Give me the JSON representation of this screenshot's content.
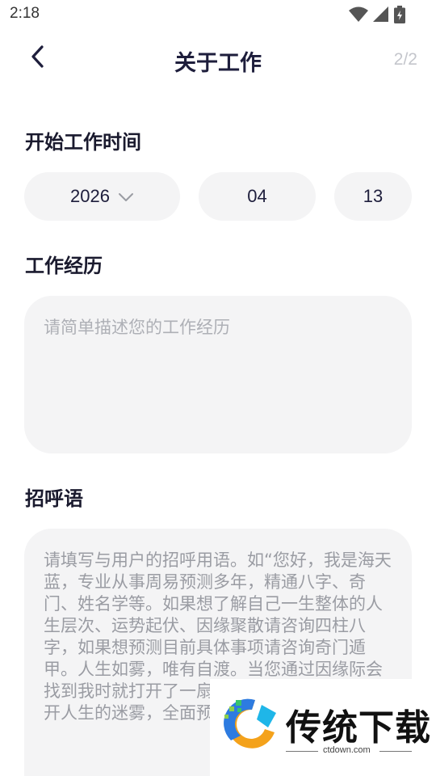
{
  "status": {
    "time": "2:18"
  },
  "nav": {
    "title": "关于工作",
    "step": "2/2"
  },
  "start_time": {
    "label": "开始工作时间",
    "year": "2026",
    "month": "04",
    "day": "13"
  },
  "experience": {
    "label": "工作经历",
    "placeholder": "请简单描述您的工作经历"
  },
  "greeting": {
    "label": "招呼语",
    "text": "请填写与用户的招呼用语。如“您好，我是海天蓝，专业从事周易预测多年，精通八字、奇门、姓名学等。如果想了解自己一生整体的人生层次、运势起伏、因缘聚散请咨询四柱八字，如果想预测目前具体事项请咨询奇门遁甲。人生如雾，唯有自渡。当您通过因缘际会找到我时就打开了一扇自渡之门，我将为您拨开人生的迷雾，全面预览人生道路"
  },
  "watermark": {
    "name": "传统下载",
    "url": "ctdown.com"
  },
  "colors": {
    "accent": "#1e1e3c",
    "field_bg": "#f4f4f5",
    "placeholder": "#aeb0b6"
  }
}
